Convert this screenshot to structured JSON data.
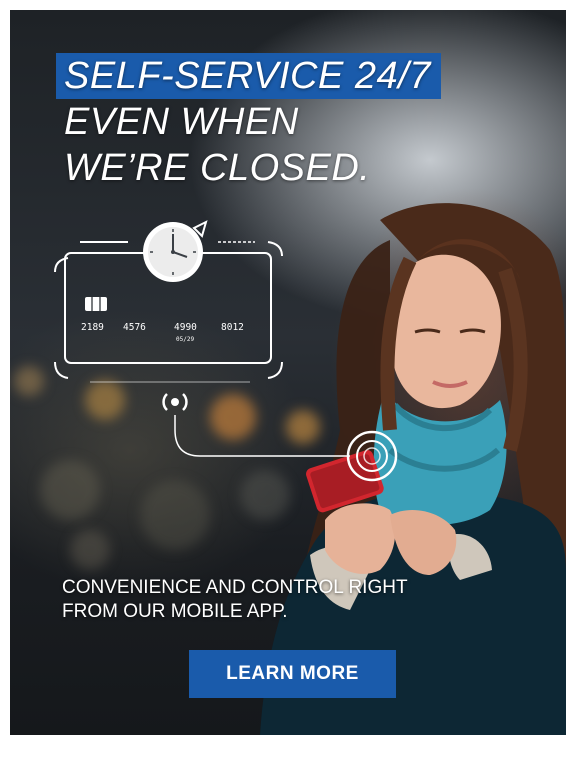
{
  "headline": {
    "line1": "SELF-SERVICE 24/7",
    "line2": "EVEN WHEN",
    "line3": "WE’RE CLOSED."
  },
  "card": {
    "number_groups": [
      "2189",
      "4576",
      "4990",
      "8012"
    ],
    "expiry": "05/29"
  },
  "subtext": {
    "line1": "CONVENIENCE AND CONTROL RIGHT",
    "line2": "FROM OUR MOBILE APP."
  },
  "cta": {
    "label": "LEARN MORE"
  },
  "colors": {
    "accent": "#1a5bab",
    "text": "#ffffff"
  },
  "icons": [
    "clock-icon",
    "credit-card-icon",
    "chip-icon",
    "contactless-icon",
    "phone-tap-icon"
  ]
}
